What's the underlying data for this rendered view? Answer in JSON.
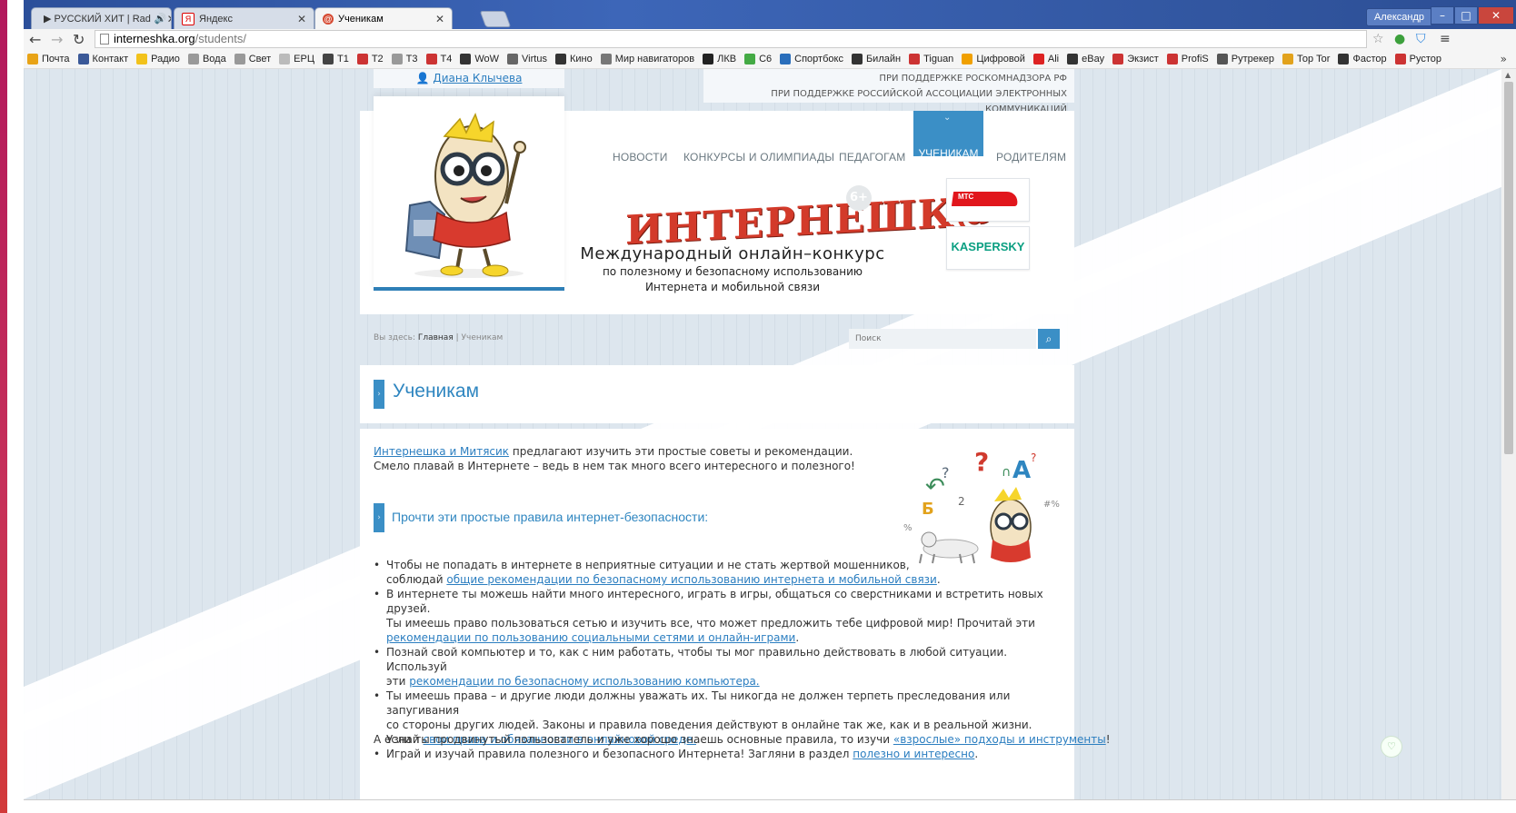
{
  "browser": {
    "tabs": [
      {
        "label": "▶ РУССКИЙ ХИТ | Rad",
        "audio": "🔊",
        "active": false
      },
      {
        "label": "Яндекс",
        "active": false
      },
      {
        "label": "Ученикам",
        "active": true
      }
    ],
    "user": "Александр",
    "window_controls": {
      "minimize": "–",
      "maximize": "□",
      "close": "✕"
    },
    "url": {
      "host": "interneshka.org",
      "path": "/students/"
    },
    "bookmarks": [
      "Почта",
      "Контакт",
      "Радио",
      "Вода",
      "Свет",
      "ЕРЦ",
      "T1",
      "T2",
      "T3",
      "T4",
      "WoW",
      "Virtus",
      "Кино",
      "Мир навигаторов",
      "ЛКВ",
      "С6",
      "Спортбокс",
      "Билайн",
      "Tiguan",
      "Цифровой",
      "Ali",
      "eBay",
      "Экзист",
      "ProfiS",
      "Рутрекер",
      "Тор Tor",
      "Фастор",
      "Рустор"
    ],
    "bookmarks_more": "»"
  },
  "site": {
    "user_name": "Диана Клычева",
    "support_lines": [
      "ПРИ ПОДДЕРЖКЕ РОСКОМНАДЗОРА РФ",
      "ПРИ ПОДДЕРЖКЕ РОССИЙСКОЙ АССОЦИАЦИИ ЭЛЕКТРОННЫХ КОММУНИКАЦИЙ"
    ],
    "menu": [
      "НОВОСТИ",
      "КОНКУРСЫ И ОЛИМПИАДЫ",
      "ПЕДАГОГАМ",
      "УЧЕНИКАМ",
      "РОДИТЕЛЯМ"
    ],
    "menu_active": "УЧЕНИКАМ",
    "brand": "ИНТЕРНЕШК@",
    "age": "6+",
    "tagline_main": "Международный онлайн–конкурс",
    "tagline_sub1": "по полезному и безопасному использованию",
    "tagline_sub2": "Интернета и мобильной связи",
    "sponsors": [
      "МТС",
      "KASPERSKY"
    ],
    "breadcrumb": {
      "prefix": "Вы здесь:",
      "home": "Главная",
      "sep": "|",
      "current": "Ученикам"
    },
    "search_placeholder": "Поиск",
    "page_title": "Ученикам",
    "intro_link": "Интернешка и Митясик",
    "intro_text": " предлагают изучить эти простые советы и рекомендации. Смело плавай в Интернете – ведь в нем так много всего интересного и полезного!",
    "rules_heading": "Прочти эти простые правила интернет-безопасности:",
    "rules": [
      {
        "pre": "Чтобы не попадать в интернете в неприятные ситуации и не стать жертвой мошенников,",
        "pre2": "соблюдай ",
        "link": "общие рекомендации по безопасному использованию интернета и мобильной связи",
        "post": "."
      },
      {
        "pre": "В интернете ты можешь найти много интересного, играть в игры, общаться со сверстниками и встретить новых друзей.",
        "pre2": "Ты имеешь право пользоваться сетью и изучить все, что может предложить тебе цифровой мир! Прочитай эти ",
        "link": "рекомендации по пользованию социальными сетями и онлайн-играми",
        "post": "."
      },
      {
        "pre": "Познай свой компьютер и то, как с ним работать, чтобы ты мог правильно действовать в любой ситуации. Используй",
        "pre2": "эти ",
        "link": "рекомендации по безопасному использованию компьютера.",
        "post": ""
      },
      {
        "pre": "Ты имеешь права – и другие люди должны уважать их. Ты никогда не должен терпеть преследования или запугивания",
        "pre2": "со стороны других людей. Законы и правила поведения действуют в онлайне так же, как и в реальной жизни. Узнай ",
        "link": "свои права и обязанности в онлайновой среде.",
        "post": ""
      },
      {
        "pre": "Играй и изучай правила полезного и безопасного Интернета! Загляни в раздел ",
        "pre2": "",
        "link": "полезно и интересно",
        "post": "."
      }
    ],
    "outro_text": "А если ты продвинутый пользователь и уже хорошо знаешь основные правила, то изучи ",
    "outro_link": "«взрослые» подходы и инструменты",
    "outro_post": "!"
  }
}
